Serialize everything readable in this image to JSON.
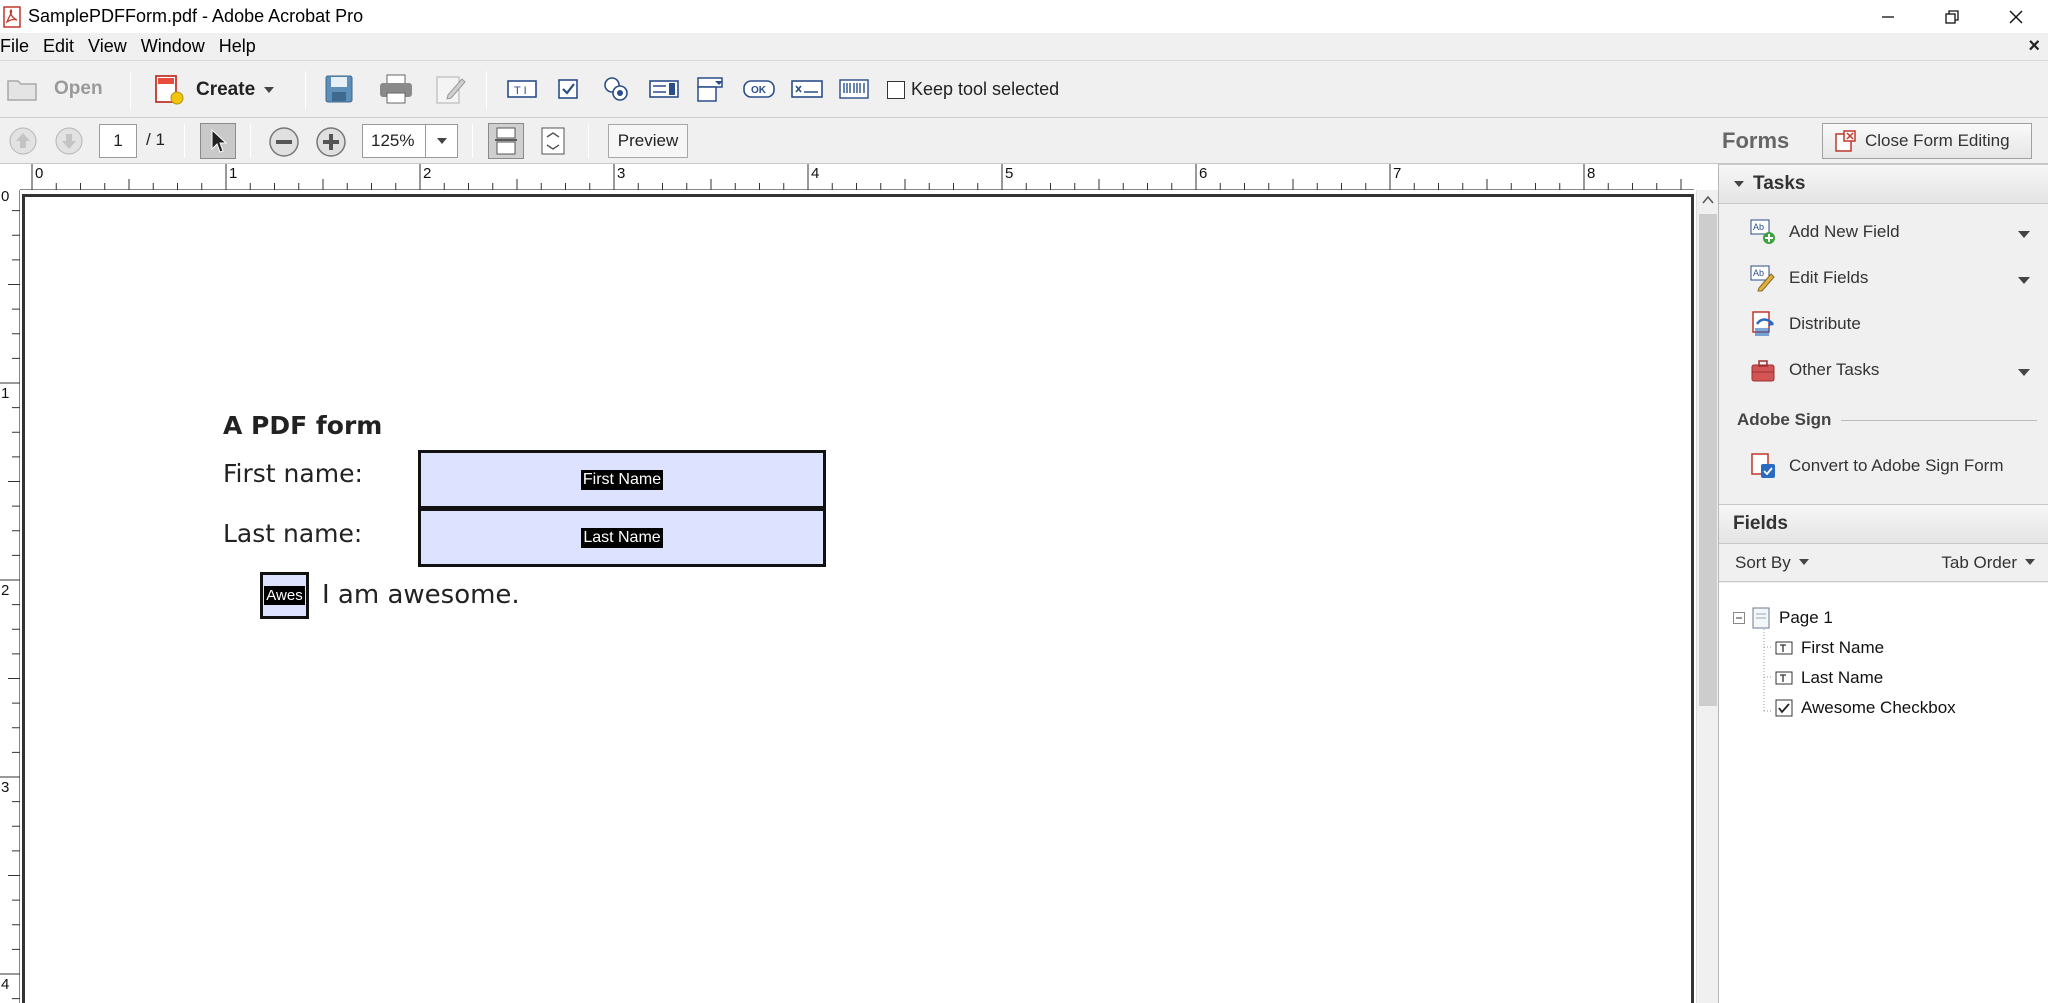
{
  "window": {
    "title": "SamplePDFForm.pdf - Adobe Acrobat Pro"
  },
  "menubar": {
    "items": [
      "File",
      "Edit",
      "View",
      "Window",
      "Help"
    ],
    "close_label": "×"
  },
  "toolbar": {
    "open_label": "Open",
    "create_label": "Create",
    "keep_tool_label": "Keep tool selected",
    "ok_label": "OK"
  },
  "navbar": {
    "page_current": "1",
    "page_total": "/ 1",
    "zoom": "125%",
    "preview_label": "Preview",
    "forms_label": "Forms",
    "close_form_editing_label": "Close Form Editing"
  },
  "ruler": {
    "h_labels": [
      "0",
      "1",
      "2",
      "3",
      "4",
      "5",
      "6",
      "7",
      "8"
    ],
    "v_labels": [
      "0",
      "1",
      "2",
      "3",
      "4"
    ]
  },
  "document": {
    "heading": "A PDF form",
    "first_name_label": "First name:",
    "last_name_label": "Last name:",
    "first_name_field": "First Name",
    "last_name_field": "Last Name",
    "checkbox_field": "Awes",
    "checkbox_text": "I am awesome."
  },
  "panel": {
    "tasks_header": "Tasks",
    "tasks": [
      {
        "label": "Add New Field",
        "icon": "add-field-icon"
      },
      {
        "label": "Edit Fields",
        "icon": "edit-fields-icon"
      },
      {
        "label": "Distribute",
        "icon": "distribute-icon"
      },
      {
        "label": "Other Tasks",
        "icon": "briefcase-icon"
      }
    ],
    "adobe_sign_label": "Adobe Sign",
    "convert_label": "Convert to Adobe Sign Form",
    "fields_header": "Fields",
    "sort_by_label": "Sort By",
    "tab_order_label": "Tab Order",
    "tree": {
      "page_label": "Page 1",
      "items": [
        "First Name",
        "Last Name",
        "Awesome Checkbox"
      ]
    }
  }
}
